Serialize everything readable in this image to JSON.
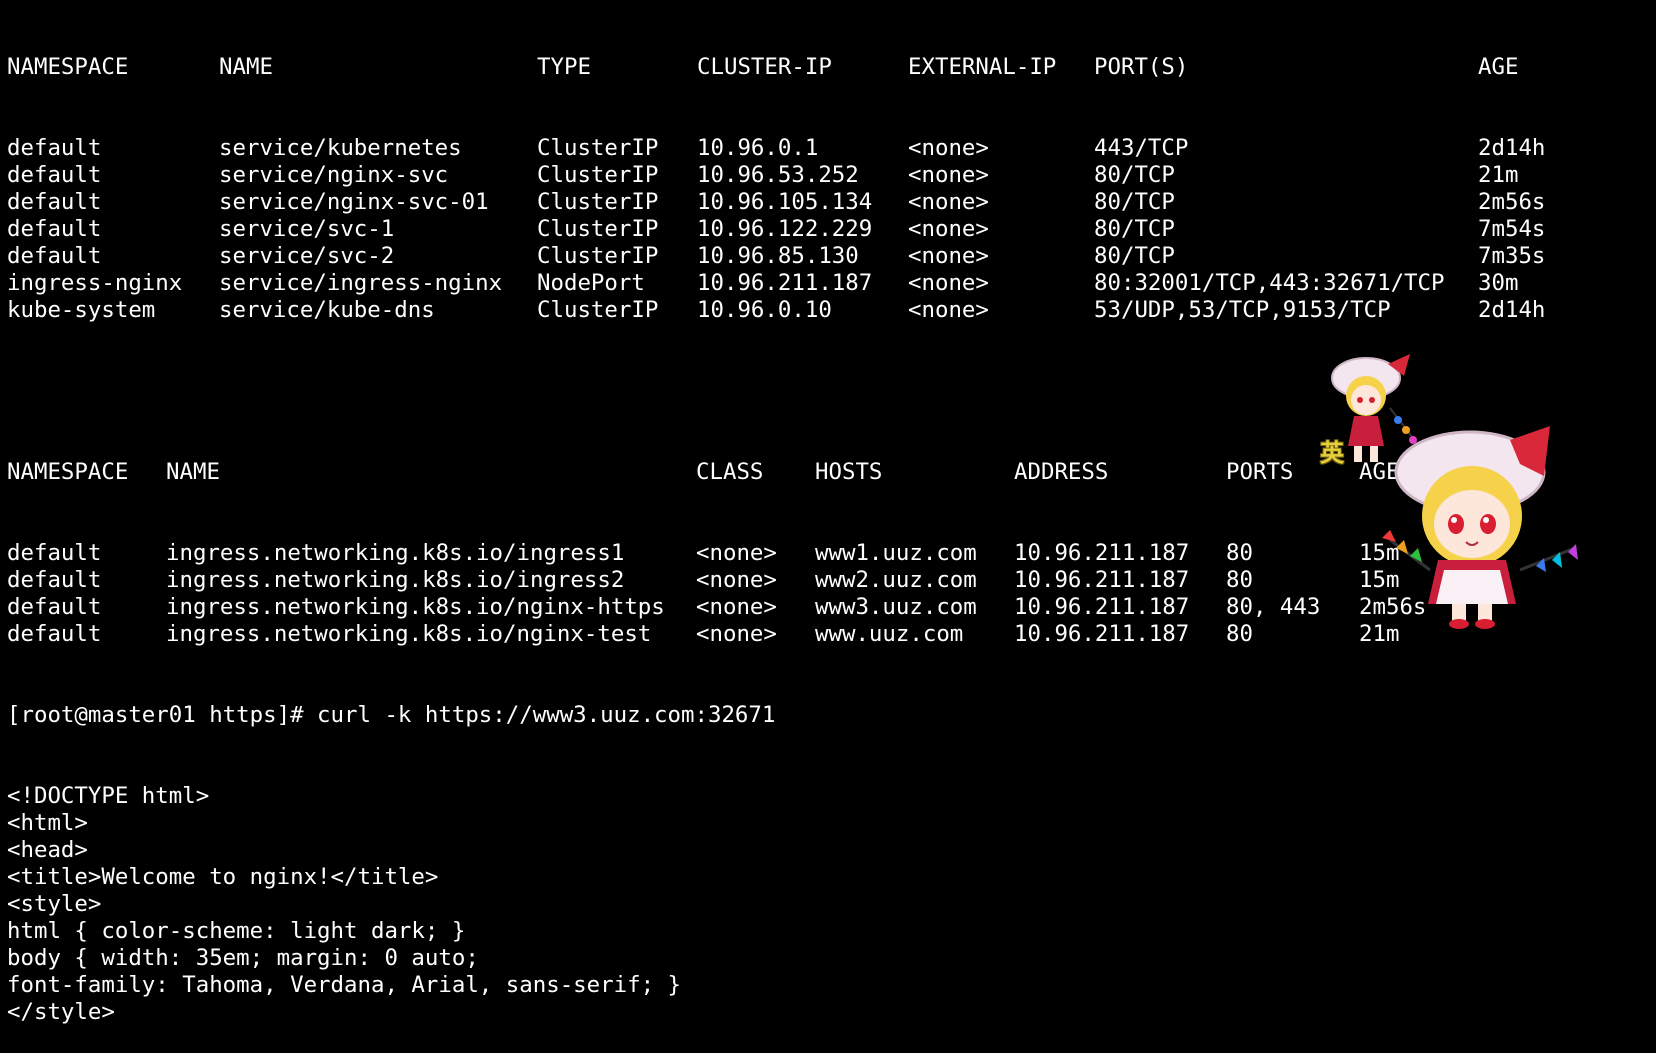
{
  "services": {
    "headers": [
      "NAMESPACE",
      "NAME",
      "TYPE",
      "CLUSTER-IP",
      "EXTERNAL-IP",
      "PORT(S)",
      "AGE"
    ],
    "rows": [
      [
        "default",
        "service/kubernetes",
        "ClusterIP",
        "10.96.0.1",
        "<none>",
        "443/TCP",
        "2d14h"
      ],
      [
        "default",
        "service/nginx-svc",
        "ClusterIP",
        "10.96.53.252",
        "<none>",
        "80/TCP",
        "21m"
      ],
      [
        "default",
        "service/nginx-svc-01",
        "ClusterIP",
        "10.96.105.134",
        "<none>",
        "80/TCP",
        "2m56s"
      ],
      [
        "default",
        "service/svc-1",
        "ClusterIP",
        "10.96.122.229",
        "<none>",
        "80/TCP",
        "7m54s"
      ],
      [
        "default",
        "service/svc-2",
        "ClusterIP",
        "10.96.85.130",
        "<none>",
        "80/TCP",
        "7m35s"
      ],
      [
        "ingress-nginx",
        "service/ingress-nginx",
        "NodePort",
        "10.96.211.187",
        "<none>",
        "80:32001/TCP,443:32671/TCP",
        "30m"
      ],
      [
        "kube-system",
        "service/kube-dns",
        "ClusterIP",
        "10.96.0.10",
        "<none>",
        "53/UDP,53/TCP,9153/TCP",
        "2d14h"
      ]
    ]
  },
  "ingresses": {
    "headers": [
      "NAMESPACE",
      "NAME",
      "CLASS",
      "HOSTS",
      "ADDRESS",
      "PORTS",
      "AGE"
    ],
    "rows": [
      [
        "default",
        "ingress.networking.k8s.io/ingress1",
        "<none>",
        "www1.uuz.com",
        "10.96.211.187",
        "80",
        "15m"
      ],
      [
        "default",
        "ingress.networking.k8s.io/ingress2",
        "<none>",
        "www2.uuz.com",
        "10.96.211.187",
        "80",
        "15m"
      ],
      [
        "default",
        "ingress.networking.k8s.io/nginx-https",
        "<none>",
        "www3.uuz.com",
        "10.96.211.187",
        "80, 443",
        "2m56s"
      ],
      [
        "default",
        "ingress.networking.k8s.io/nginx-test",
        "<none>",
        "www.uuz.com",
        "10.96.211.187",
        "80",
        "21m"
      ]
    ]
  },
  "prompt": "[root@master01 https]# curl -k https://www3.uuz.com:32671",
  "output_lines": [
    "<!DOCTYPE html>",
    "<html>",
    "<head>",
    "<title>Welcome to nginx!</title>",
    "<style>",
    "html { color-scheme: light dark; }",
    "body { width: 35em; margin: 0 auto;",
    "font-family: Tahoma, Verdana, Arial, sans-serif; }",
    "</style>"
  ],
  "ime_indicator": "英",
  "overlay": {
    "description_icon": "chibi-character-sprite-icon",
    "colors": {
      "hat": "#f4e6ee",
      "ribbon": "#d8283a",
      "hair": "#f6d14a",
      "dress": "#c8203c",
      "eyes": "#d81e30"
    }
  },
  "theme": {
    "background": "#000000",
    "foreground": "#ffffff"
  }
}
